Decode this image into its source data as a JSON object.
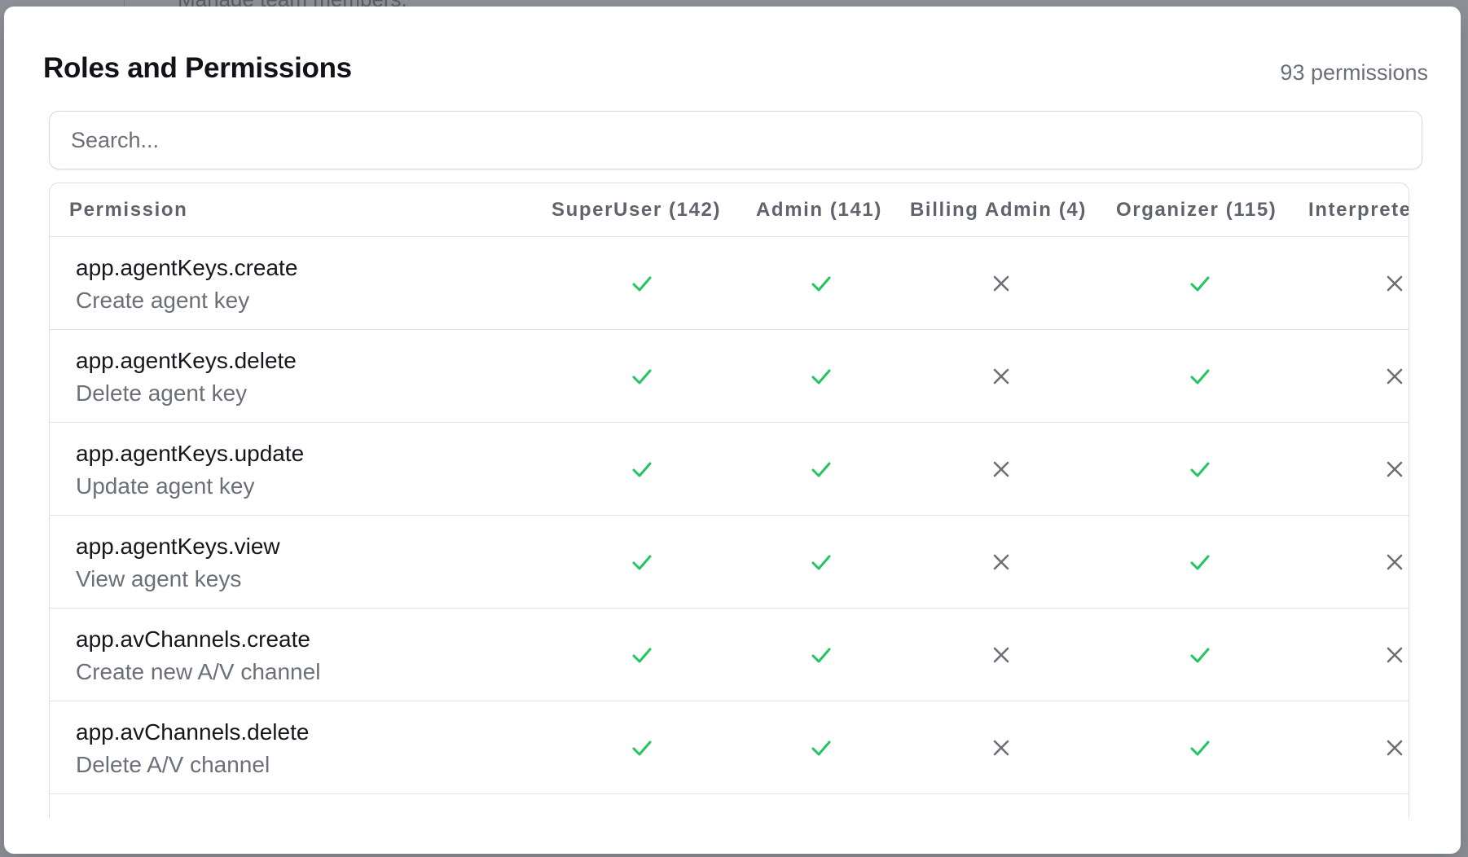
{
  "background": {
    "subtitle_text": "Manage team members."
  },
  "modal": {
    "title": "Roles and Permissions",
    "count_label": "93 permissions"
  },
  "search": {
    "placeholder": "Search..."
  },
  "table": {
    "headers": {
      "permission": "Permission",
      "roles": [
        "SuperUser (142)",
        "Admin (141)",
        "Billing Admin (4)",
        "Organizer (115)",
        "Interpreter"
      ]
    },
    "rows": [
      {
        "key": "app.agentKeys.create",
        "description": "Create agent key",
        "grants": [
          true,
          true,
          false,
          true,
          false
        ]
      },
      {
        "key": "app.agentKeys.delete",
        "description": "Delete agent key",
        "grants": [
          true,
          true,
          false,
          true,
          false
        ]
      },
      {
        "key": "app.agentKeys.update",
        "description": "Update agent key",
        "grants": [
          true,
          true,
          false,
          true,
          false
        ]
      },
      {
        "key": "app.agentKeys.view",
        "description": "View agent keys",
        "grants": [
          true,
          true,
          false,
          true,
          false
        ]
      },
      {
        "key": "app.avChannels.create",
        "description": "Create new A/V channel",
        "grants": [
          true,
          true,
          false,
          true,
          false
        ]
      },
      {
        "key": "app.avChannels.delete",
        "description": "Delete A/V channel",
        "grants": [
          true,
          true,
          false,
          true,
          false
        ]
      }
    ]
  },
  "icons": {
    "granted": "check-icon",
    "denied": "x-icon"
  },
  "colors": {
    "granted": "#22c55e",
    "denied": "#6b6f78"
  }
}
